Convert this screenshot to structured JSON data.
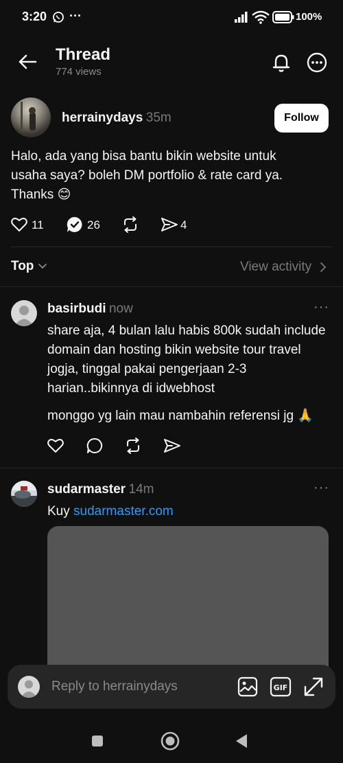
{
  "status_bar": {
    "time": "3:20",
    "dots": "···",
    "battery": "100%"
  },
  "header": {
    "title": "Thread",
    "subtitle": "774 views"
  },
  "post": {
    "username": "herrainydays",
    "time": "35m",
    "follow_label": "Follow",
    "text": "Halo, ada yang bisa bantu bikin website untuk usaha saya? boleh DM portfolio & rate card ya. Thanks 😊",
    "likes": "11",
    "replies": "26",
    "shares": "4"
  },
  "sort": {
    "label": "Top",
    "view_activity": "View activity"
  },
  "replies": [
    {
      "username": "basirbudi",
      "time": "now",
      "more": "···",
      "text1": "share aja, 4 bulan lalu habis 800k sudah include domain dan hosting bikin website tour travel jogja,  tinggal pakai pengerjaan 2-3 harian..bikinnya di idwebhost",
      "text2": "monggo yg lain mau nambahin referensi jg 🙏"
    },
    {
      "username": "sudarmaster",
      "time": "14m",
      "more": "···",
      "text_prefix": "Kuy ",
      "link": "sudarmaster.com"
    }
  ],
  "reply_bar": {
    "placeholder": "Reply to herrainydays"
  },
  "colors": {
    "background": "#101010",
    "link": "#3897f0",
    "muted": "#8a8a8a"
  }
}
